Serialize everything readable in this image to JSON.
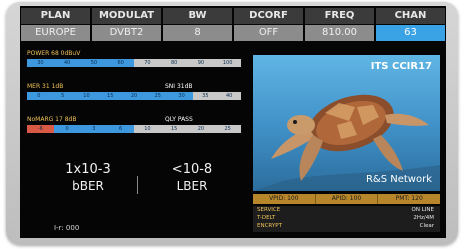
{
  "header": {
    "titles": [
      "PLAN",
      "MODULAT",
      "BW",
      "DCORF",
      "FREQ",
      "CHAN"
    ],
    "values": [
      "EUROPE",
      "DVBT2",
      "8",
      "OFF",
      "810.00",
      "63"
    ],
    "active_index": 5
  },
  "meters": {
    "power": {
      "label": "POWER  68 0dBuV",
      "scale": [
        "30",
        "40",
        "50",
        "60",
        "70",
        "80",
        "90",
        "100"
      ],
      "fill_fraction": 0.45
    },
    "mer": {
      "label": "MER  31 1dB",
      "snr": "SNI 31dB",
      "scale": [
        "0",
        "5",
        "10",
        "15",
        "20",
        "25",
        "30",
        "35",
        "40"
      ],
      "fill_fraction": 0.78
    },
    "nmargin": {
      "label": "NoMARG 17 8dB",
      "quality": "QLY PASS",
      "scale": [
        "-6",
        "0",
        "3",
        "6",
        "10",
        "15",
        "20",
        "25"
      ],
      "fill_fraction": 0.48
    }
  },
  "ber": {
    "bber_value": "1x10-3",
    "bber_label": "bBER",
    "lber_value": "<10-8",
    "lber_label": "LBER",
    "footer": "I-r: 000"
  },
  "video": {
    "title": "ITS CCIR17",
    "network": "R&S Network"
  },
  "pids": {
    "items": [
      "VPID: 100",
      "APID: 100",
      "PMT: 120"
    ]
  },
  "info": {
    "lines": [
      {
        "key": "SERVICE",
        "value": "ON LINE"
      },
      {
        "key": "T-DELT",
        "value": "2Hz/4M"
      },
      {
        "key": "ENCRYPT",
        "value": "Clear"
      }
    ]
  },
  "colors": {
    "active_tab": "#3aa3e6",
    "meter_fill": "#3e98de",
    "margin_fill": "#d85a44",
    "label": "#f2c35a"
  }
}
